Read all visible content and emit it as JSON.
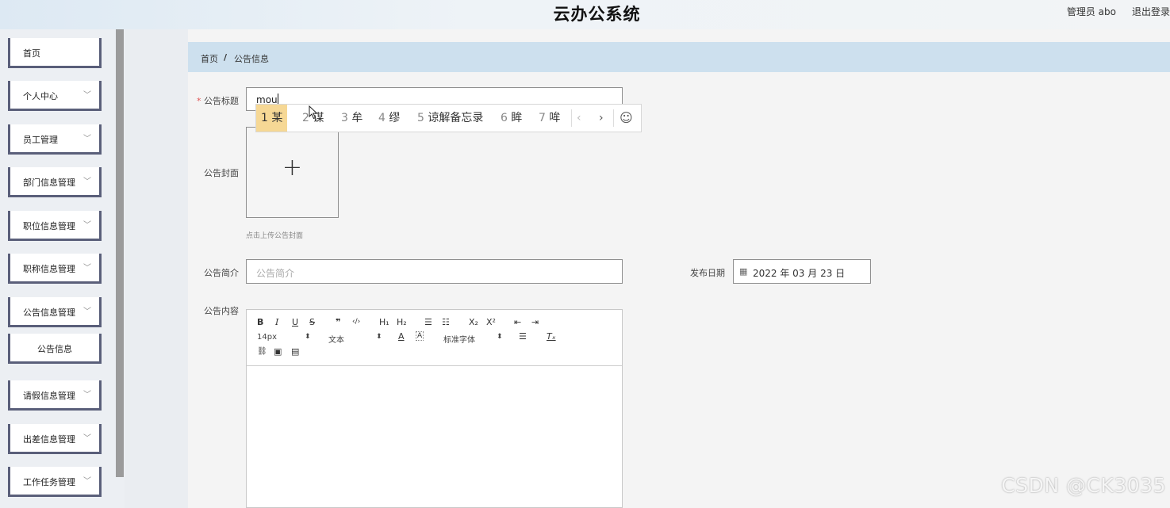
{
  "header": {
    "app_title": "云办公系统",
    "user_label": "管理员 abo",
    "logout_label": "退出登录"
  },
  "sidebar": {
    "items": [
      {
        "label": "首页",
        "has_arrow": false
      },
      {
        "label": "个人中心",
        "has_arrow": true
      },
      {
        "label": "员工管理",
        "has_arrow": true
      },
      {
        "label": "部门信息管理",
        "has_arrow": true
      },
      {
        "label": "职位信息管理",
        "has_arrow": true
      },
      {
        "label": "职称信息管理",
        "has_arrow": true
      },
      {
        "label": "公告信息管理",
        "has_arrow": true
      },
      {
        "label": "公告信息",
        "has_arrow": false
      },
      {
        "label": "请假信息管理",
        "has_arrow": true
      },
      {
        "label": "出差信息管理",
        "has_arrow": true
      },
      {
        "label": "工作任务管理",
        "has_arrow": true
      }
    ],
    "chevron_icon": "chevron-down-icon"
  },
  "breadcrumb": {
    "home": "首页",
    "separator": "/",
    "current": "公告信息"
  },
  "form": {
    "title_required_mark": "*",
    "title_label": "公告标题",
    "title_value": "mou",
    "cover_label": "公告封面",
    "cover_hint": "点击上传公告封面",
    "summary_label": "公告简介",
    "summary_placeholder": "公告简介",
    "date_label": "发布日期",
    "date_value": "2022 年 03 月 23 日",
    "content_label": "公告内容"
  },
  "ime": {
    "candidates": [
      {
        "num": "1",
        "text": "某"
      },
      {
        "num": "2",
        "text": "谋"
      },
      {
        "num": "3",
        "text": "牟"
      },
      {
        "num": "4",
        "text": "缪"
      },
      {
        "num": "5",
        "text": "谅解备忘录"
      },
      {
        "num": "6",
        "text": "眸"
      },
      {
        "num": "7",
        "text": "哞"
      }
    ],
    "prev_label": "‹",
    "next_label": "›",
    "emoji_label": "☺"
  },
  "editor": {
    "toolbar_row1": [
      "B",
      "I",
      "U",
      "S",
      "❞",
      "‹/›",
      "H₁",
      "H₂",
      "☰",
      "☷",
      "X₂",
      "X²",
      "⇤",
      "⇥"
    ],
    "font_size": "14px",
    "text_style": "文本",
    "font_family": "标准字体",
    "color_a": "A",
    "bg_a": "A",
    "align": "☰",
    "clear_format": "Tₓ",
    "row3": [
      "🔗",
      "▣",
      "▤"
    ]
  },
  "watermark": "CSDN @CK3035",
  "colors": {
    "accent_highlight": "#f6d895",
    "breadcrumb_bg": "#cde0ee",
    "sidebar_border": "#5a5f7a"
  }
}
